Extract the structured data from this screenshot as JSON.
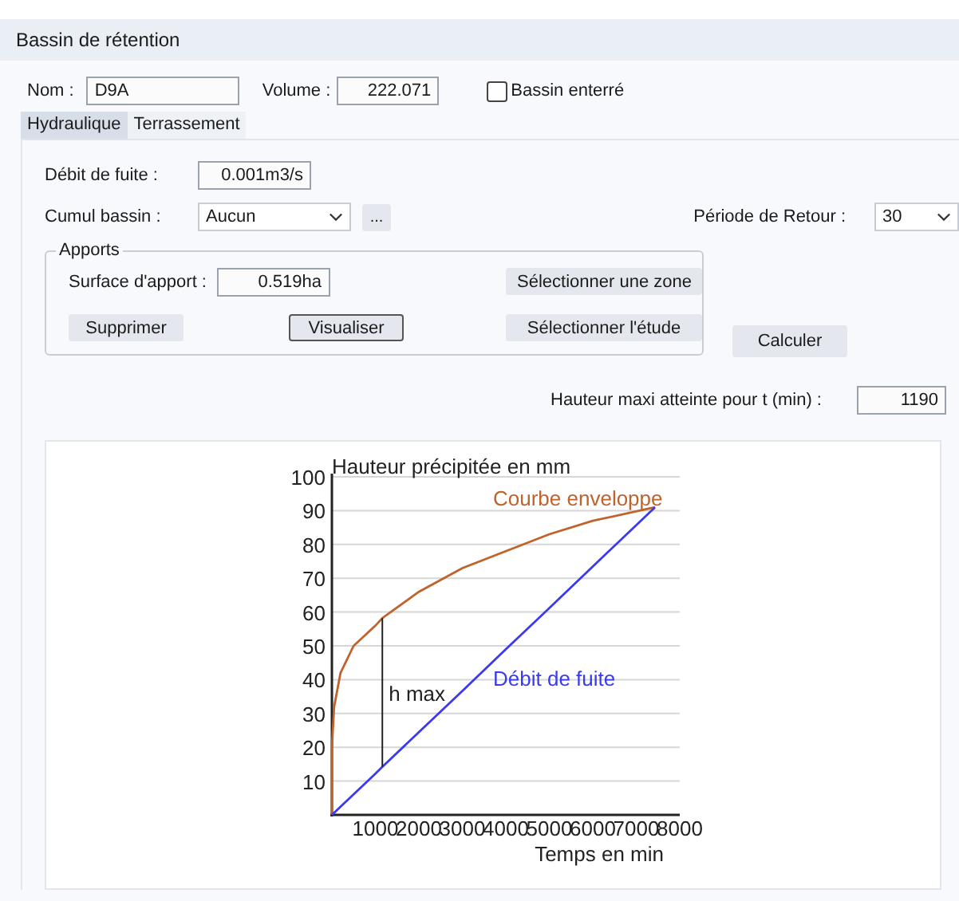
{
  "window": {
    "title": "Bassin de rétention"
  },
  "header": {
    "nom": {
      "label": "Nom :",
      "value": "D9A"
    },
    "volume": {
      "label": "Volume :",
      "value": "222.071"
    },
    "bassin_enterre": {
      "label": "Bassin enterré",
      "checked": false
    }
  },
  "tabs": [
    {
      "label": "Hydraulique",
      "selected": true
    },
    {
      "label": "Terrassement",
      "selected": false
    }
  ],
  "debit_fuite": {
    "label": "Débit de fuite :",
    "value": "0.001m3/s"
  },
  "cumul_bassin": {
    "label": "Cumul bassin :",
    "value": "Aucun",
    "more_button": "..."
  },
  "periode_retour": {
    "label": "Période de Retour :",
    "value": "30"
  },
  "apports": {
    "title": "Apports",
    "surface": {
      "label": "Surface d'apport :",
      "value": "0.519ha"
    },
    "buttons": [
      {
        "label": "Sélectionner une zone",
        "kind": "plain"
      },
      {
        "label": "Supprimer",
        "kind": "plain"
      },
      {
        "label": "Visualiser",
        "kind": "default"
      },
      {
        "label": "Sélectionner l'étude",
        "kind": "plain"
      }
    ]
  },
  "calculer_button": "Calculer",
  "hauteur_maxi": {
    "label": "Hauteur maxi atteinte pour t (min) :",
    "value": "1190"
  },
  "chart": {
    "chart_data": {
      "type": "line",
      "ylabel": "Hauteur précipitée en mm",
      "xlabel": "Temps en min",
      "x": [
        0,
        0,
        50,
        200,
        500,
        1000,
        1160,
        2000,
        3000,
        4000,
        5000,
        6000,
        7430
      ],
      "series": [
        {
          "name": "Courbe enveloppe",
          "color": "#c0622b",
          "values": [
            0,
            20,
            32,
            42,
            50,
            56,
            58.2,
            66,
            73,
            78,
            83,
            87,
            91
          ]
        },
        {
          "name": "Débit de fuite",
          "color": "#3a3af0",
          "values": [
            0,
            0,
            0.6,
            2.4,
            6.1,
            12.2,
            14.2,
            24.5,
            36.7,
            49,
            61.2,
            73.5,
            91
          ]
        }
      ],
      "xlim": [
        0,
        8000
      ],
      "ylim": [
        0,
        100
      ],
      "xticks": [
        1000,
        2000,
        3000,
        4000,
        5000,
        6000,
        7000,
        8000
      ],
      "yticks": [
        10,
        20,
        30,
        40,
        50,
        60,
        70,
        80,
        90,
        100
      ],
      "grid": true,
      "annotations": [
        "h max"
      ]
    }
  }
}
